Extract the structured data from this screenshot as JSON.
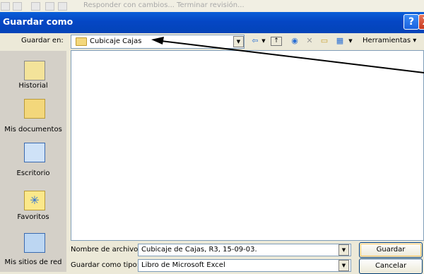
{
  "window": {
    "title": "Guardar como",
    "help": "?",
    "close": "X"
  },
  "strip": {
    "text": "Responder con cambios... Terminar revisión..."
  },
  "save_in": {
    "label": "Guardar en:",
    "value": "Cubicaje Cajas"
  },
  "toolbar": {
    "tools_label": "Herramientas",
    "icons": [
      "back-icon",
      "up-folder-icon",
      "search-web-icon",
      "delete-icon",
      "new-folder-icon",
      "views-icon"
    ]
  },
  "places": [
    {
      "label": "Historial",
      "icon": "history-icon"
    },
    {
      "label": "Mis documentos",
      "icon": "my-documents-icon"
    },
    {
      "label": "Escritorio",
      "icon": "desktop-icon"
    },
    {
      "label": "Favoritos",
      "icon": "favorites-icon"
    },
    {
      "label": "Mis sitios de red",
      "icon": "network-places-icon"
    }
  ],
  "filename": {
    "label": "Nombre de archivo:",
    "value": "Cubicaje de Cajas, R3, 15-09-03."
  },
  "filetype": {
    "label": "Guardar como tipo:",
    "value": "Libro de Microsoft Excel"
  },
  "buttons": {
    "save": "Guardar",
    "cancel": "Cancelar"
  },
  "colors": {
    "titlebar": "#0a5fd8",
    "dialog_bg": "#ece9d8"
  }
}
